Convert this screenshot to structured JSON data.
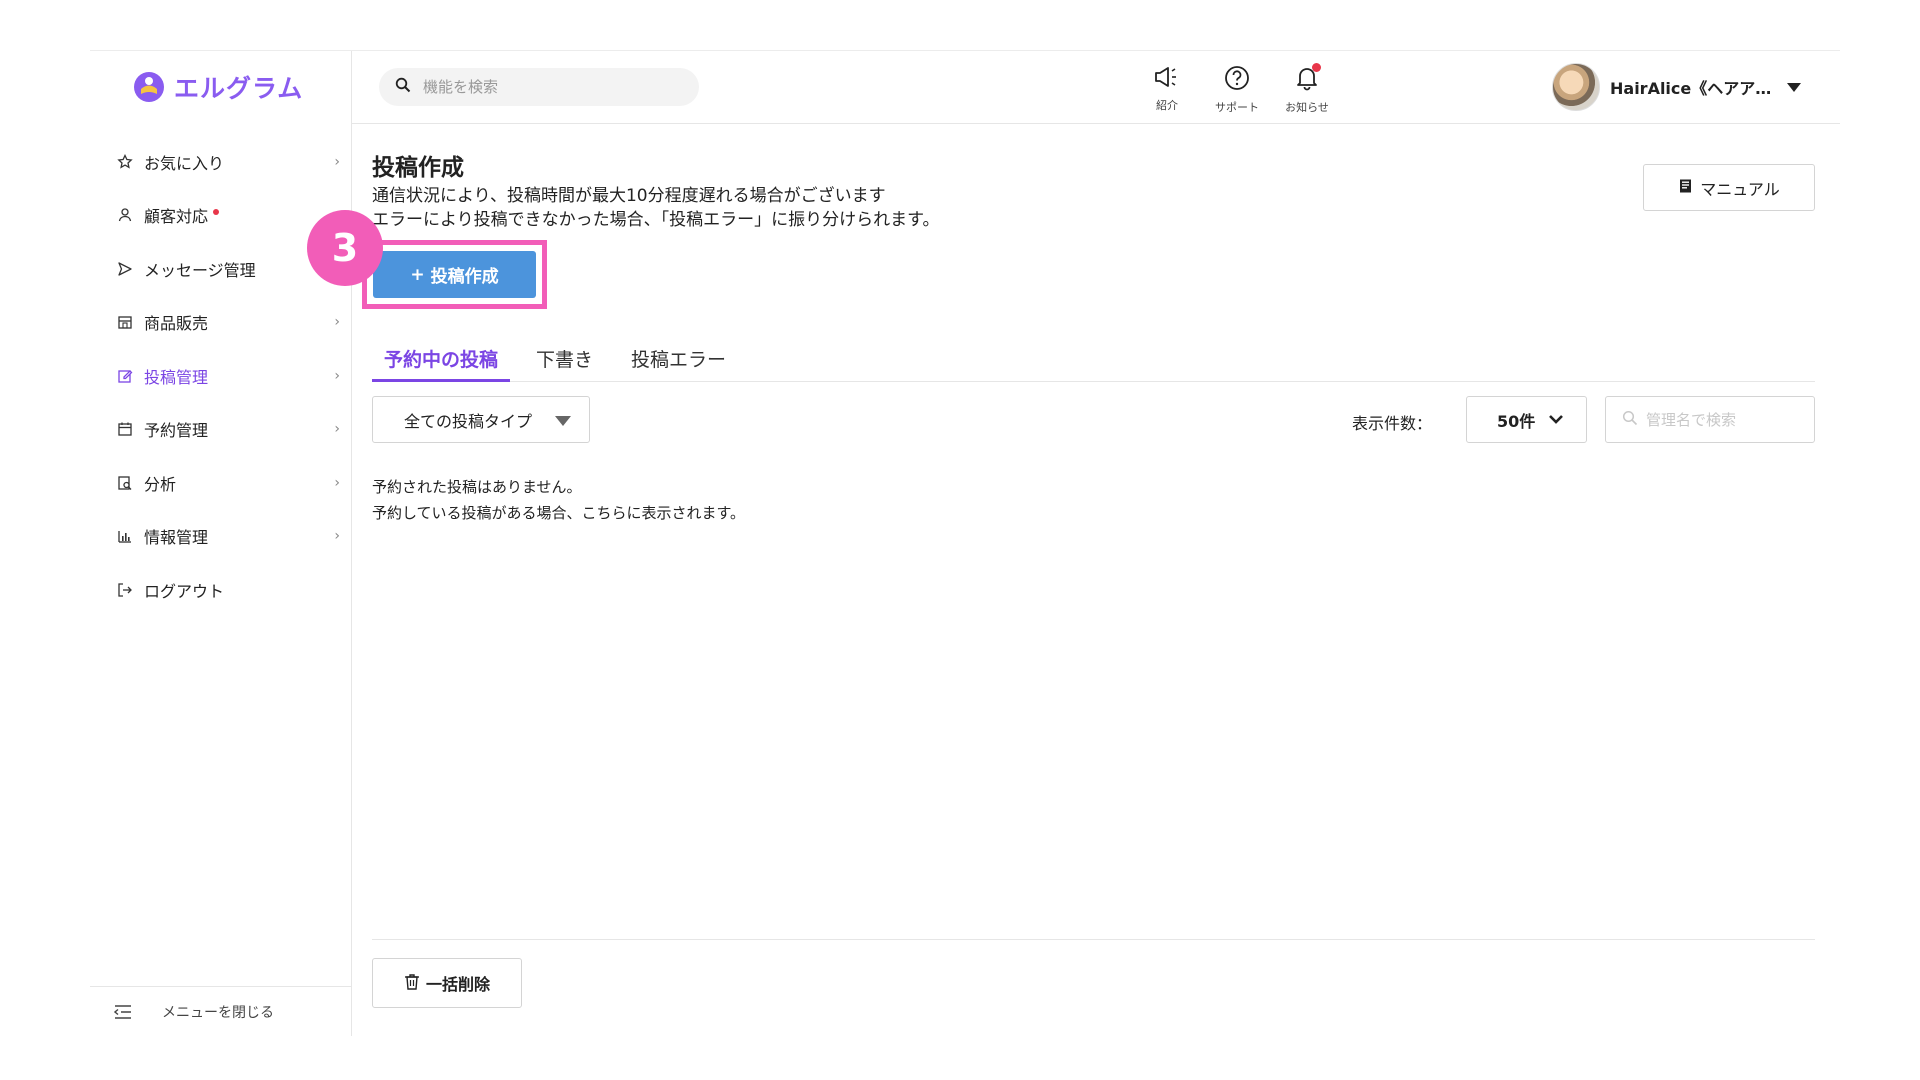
{
  "brand": {
    "name": "エルグラム",
    "accent": "#8a5cf0"
  },
  "sidebar": {
    "items": [
      {
        "label": "お気に入り",
        "icon": "star-icon",
        "has_chevron": true
      },
      {
        "label": "顧客対応",
        "icon": "person-icon",
        "has_chevron": false,
        "badge": "red-dot"
      },
      {
        "label": "メッセージ管理",
        "icon": "send-icon",
        "has_chevron": false
      },
      {
        "label": "商品販売",
        "icon": "store-icon",
        "has_chevron": true
      },
      {
        "label": "投稿管理",
        "icon": "edit-icon",
        "has_chevron": true,
        "active": true
      },
      {
        "label": "予約管理",
        "icon": "calendar-icon",
        "has_chevron": true
      },
      {
        "label": "分析",
        "icon": "analysis-icon",
        "has_chevron": true
      },
      {
        "label": "情報管理",
        "icon": "bar-chart-icon",
        "has_chevron": true
      },
      {
        "label": "ログアウト",
        "icon": "logout-icon",
        "has_chevron": false
      }
    ],
    "footer_label": "メニューを閉じる"
  },
  "header": {
    "search_placeholder": "機能を検索",
    "buttons": [
      {
        "label": "紹介",
        "icon": "megaphone-icon"
      },
      {
        "label": "サポート",
        "icon": "help-icon"
      },
      {
        "label": "お知らせ",
        "icon": "bell-icon"
      }
    ],
    "user_name": "HairAlice《ヘアア…"
  },
  "main": {
    "title": "投稿作成",
    "description_lines": [
      "通信状況により、投稿時間が最大10分程度遅れる場合がございます",
      "エラーにより投稿できなかった場合、「投稿エラー」に振り分けられます。"
    ],
    "manual_label": "マニュアル",
    "create_label": "投稿作成",
    "create_prefix": "+",
    "step_number": "3",
    "tabs": [
      "予約中の投稿",
      "下書き",
      "投稿エラー"
    ],
    "active_tab": 0,
    "type_filter": "全ての投稿タイプ",
    "count_label": "表示件数：",
    "count_value": "50件",
    "mgmt_search_placeholder": "管理名で検索",
    "empty_lines": [
      "予約された投稿はありません。",
      "予約している投稿がある場合、こちらに表示されます。"
    ],
    "bulk_delete_label": "一括削除"
  },
  "colors": {
    "active_purple": "#7b45e4",
    "primary_button": "#4c94dc",
    "highlight_pink": "#f25db8",
    "notification_red": "#e8364a"
  }
}
